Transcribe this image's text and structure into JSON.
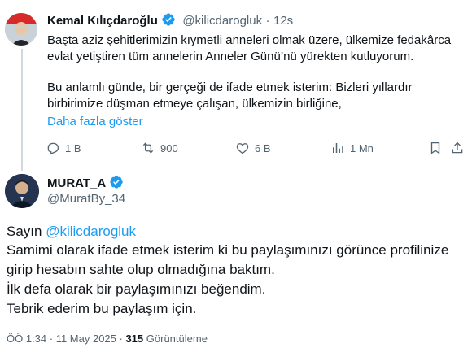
{
  "reply_tweet": {
    "author_name": "Kemal Kılıçdaroğlu",
    "handle": "@kilicdarogluk",
    "separator": "·",
    "time": "12s",
    "lines": [
      "Başta aziz şehitlerimizin kıymetli anneleri olmak üzere, ülkemize fedakârca",
      "evlat yetiştiren tüm annelerin Anneler Günü’nü yürekten kutluyorum.",
      "Bu anlamlı günde, bir gerçeği de ifade etmek isterim: Bizleri yıllardır",
      "birbirimize düşman etmeye çalışan, ülkemizin birliğine,"
    ],
    "show_more": "Daha fazla göster",
    "actions": {
      "replies": "1 B",
      "reposts": "900",
      "likes": "6 B",
      "views": "1 Mn"
    }
  },
  "main_tweet": {
    "author_name": "MURAT_A",
    "handle": "@MuratBy_34",
    "greeting_prefix": "Sayın ",
    "mention": "@kilicdarogluk",
    "lines": [
      "Samimi olarak ifade etmek isterim ki bu paylaşımınızı görünce profilinize",
      "girip hesabın sahte olup olmadığına baktım.",
      "İlk defa olarak bir paylaşımınızı beğendim.",
      "Tebrik ederim bu paylaşım için."
    ],
    "timestamp": "ÖÖ 1:34 · 11 May 2025 · ",
    "view_count": "315",
    "views_label": "Görüntüleme"
  },
  "colors": {
    "accent": "#1d9bf0",
    "text": "#0f1419",
    "muted": "#536471"
  },
  "icons": [
    "verified-badge-icon",
    "reply-icon",
    "repost-icon",
    "like-icon",
    "views-icon",
    "bookmark-icon",
    "share-icon"
  ]
}
